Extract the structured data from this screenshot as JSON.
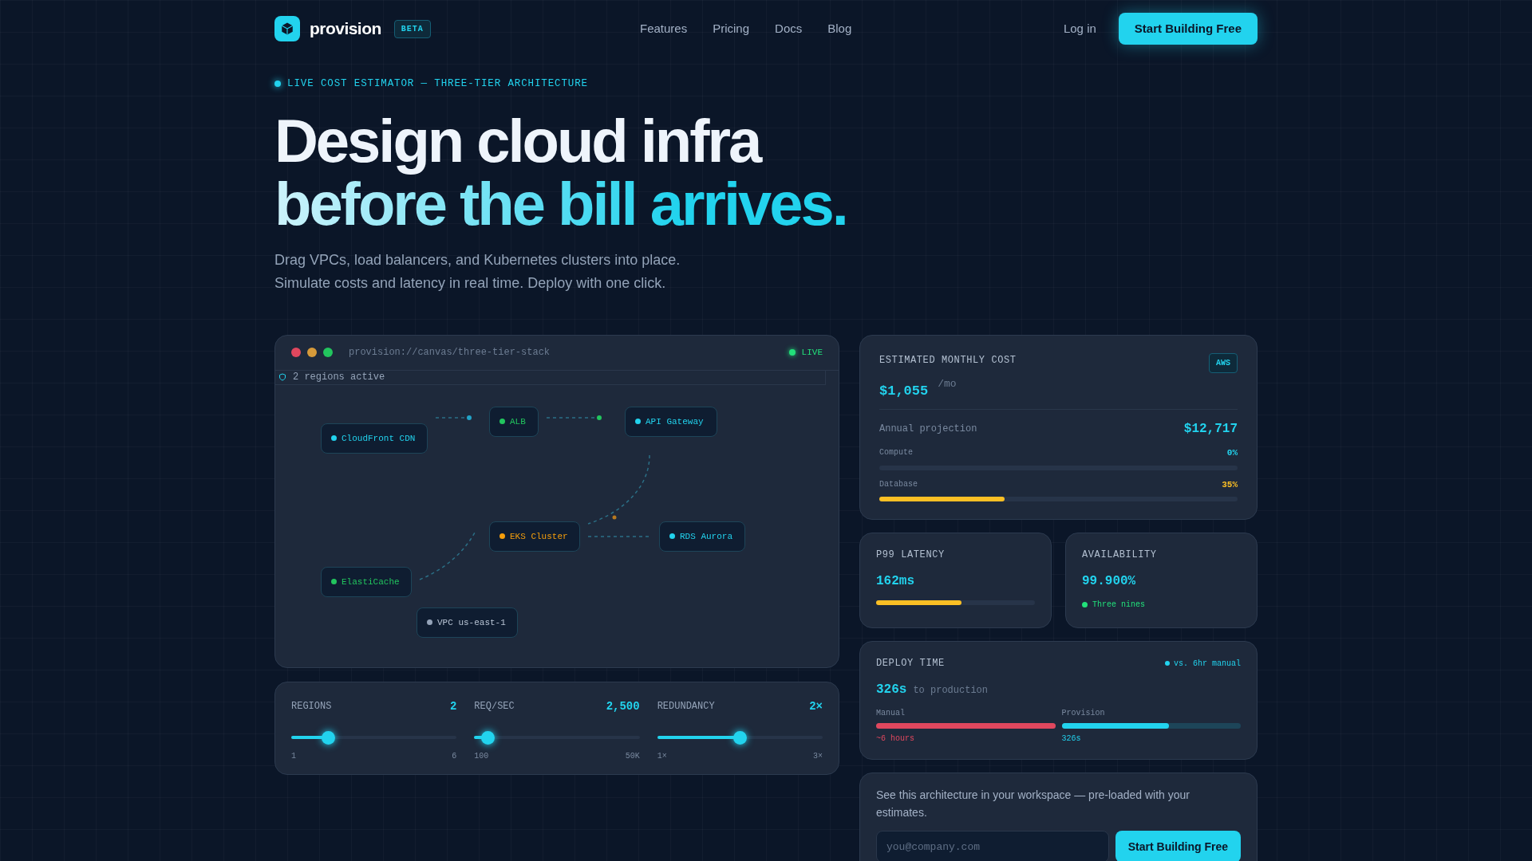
{
  "nav": {
    "brand": "provision",
    "badge": "BETA",
    "links": [
      "Features",
      "Pricing",
      "Docs",
      "Blog"
    ],
    "login": "Log in",
    "cta": "Start Building Free"
  },
  "hero": {
    "eyebrow": "LIVE COST ESTIMATOR — THREE-TIER ARCHITECTURE",
    "title_line1": "Design cloud infra",
    "title_line2": "before the bill arrives.",
    "subtitle_lines": [
      "Drag VPCs, load balancers, and Kubernetes clusters into place.",
      "Simulate costs and latency in real time. Deploy with one click."
    ]
  },
  "canvas": {
    "url": "provision://canvas/three-tier-stack",
    "status": "LIVE",
    "banner": "2 regions active",
    "nodes": [
      {
        "label": "CloudFront CDN",
        "color": "#22d3ee"
      },
      {
        "label": "ALB",
        "color": "#22c55e"
      },
      {
        "label": "API Gateway",
        "color": "#22d3ee"
      },
      {
        "label": "EKS Cluster",
        "color": "#f59e0b"
      },
      {
        "label": "RDS Aurora",
        "color": "#22d3ee"
      },
      {
        "label": "ElastiCache",
        "color": "#22c55e"
      },
      {
        "label": "VPC us-east-1",
        "color": "#94a3b8"
      }
    ]
  },
  "controls": [
    {
      "label": "REGIONS",
      "value": "2",
      "level": 0.22,
      "min": "1",
      "max": "6"
    },
    {
      "label": "REQ/SEC",
      "value": "2,500",
      "level": 0.08,
      "min": "100",
      "max": "50K"
    },
    {
      "label": "REDUNDANCY",
      "value": "2×",
      "level": 0.5,
      "min": "1×",
      "max": "3×"
    }
  ],
  "cost": {
    "title": "ESTIMATED MONTHLY COST",
    "provider": "AWS",
    "amount": "$1,055",
    "unit": "/mo",
    "annual_label": "Annual projection",
    "annual_value": "$12,717",
    "breakdown": [
      {
        "label": "Compute",
        "percent": "0%",
        "color": "#22d3ee"
      },
      {
        "label": "Database",
        "percent": "35%",
        "level": 0.35,
        "color": "#fbbf24"
      }
    ]
  },
  "latency": {
    "title": "P99 LATENCY",
    "value": "162ms",
    "level": 0.54
  },
  "availability": {
    "title": "AVAILABILITY",
    "value": "99.900%",
    "note": "Three nines"
  },
  "deploy": {
    "title": "DEPLOY TIME",
    "comparison": "vs. 6hr manual",
    "value": "326s",
    "suffix": "to production",
    "bars": [
      {
        "label": "Manual",
        "reading": "~6 hours",
        "level": 1,
        "color": "#e0475e"
      },
      {
        "label": "Provision",
        "reading": "326s",
        "level": 0.6,
        "color": "#22d3ee"
      }
    ]
  },
  "signup": {
    "text": "See this architecture in your workspace — pre-loaded with your estimates.",
    "placeholder": "you@company.com",
    "button": "Start Building Free"
  }
}
